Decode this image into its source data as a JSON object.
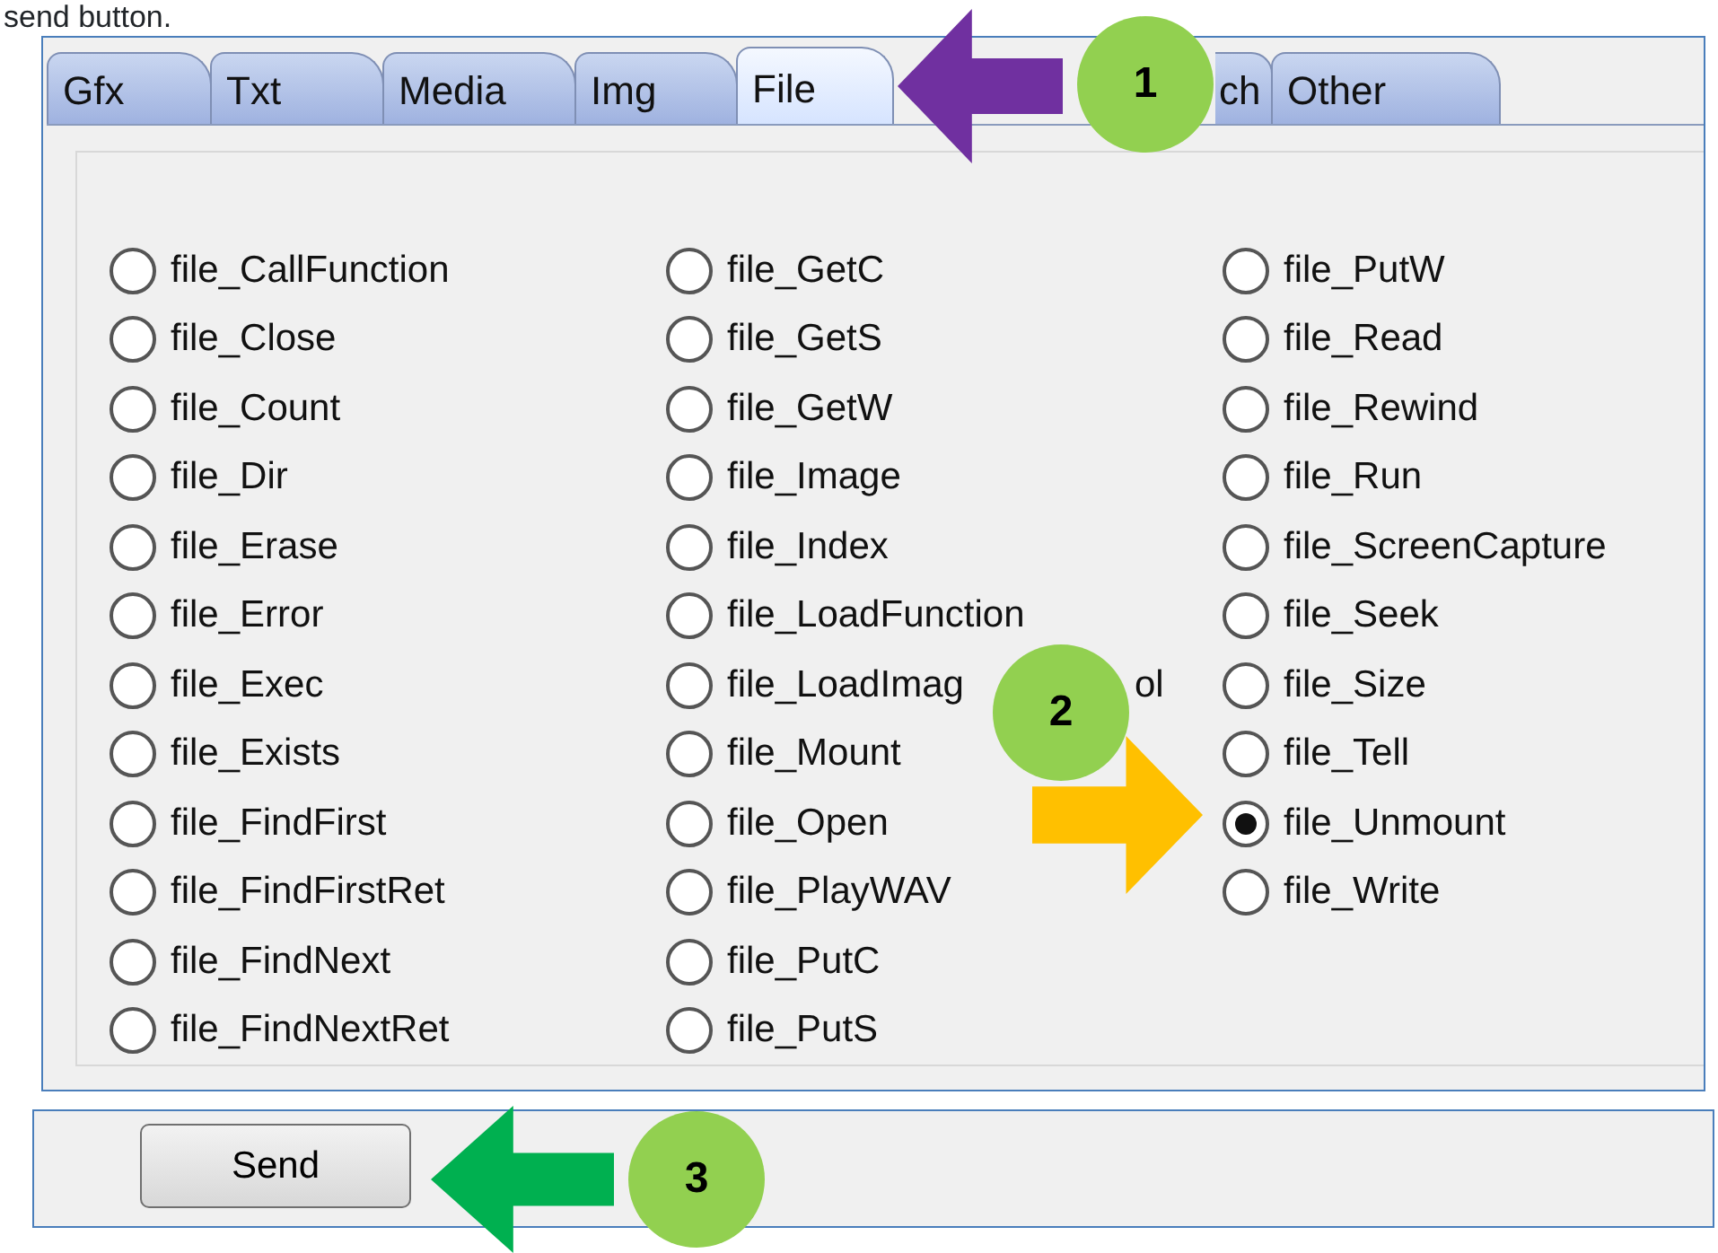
{
  "caption": "send button.",
  "tabs": [
    {
      "label": "Gfx",
      "selected": false
    },
    {
      "label": "Txt",
      "selected": false
    },
    {
      "label": "Media",
      "selected": false
    },
    {
      "label": "Img",
      "selected": false
    },
    {
      "label": "File",
      "selected": true
    },
    {
      "label": "ch",
      "selected": false
    },
    {
      "label": "Other",
      "selected": false
    }
  ],
  "options": [
    [
      {
        "label": "file_CallFunction",
        "selected": false
      },
      {
        "label": "file_Close",
        "selected": false
      },
      {
        "label": "file_Count",
        "selected": false
      },
      {
        "label": "file_Dir",
        "selected": false
      },
      {
        "label": "file_Erase",
        "selected": false
      },
      {
        "label": "file_Error",
        "selected": false
      },
      {
        "label": "file_Exec",
        "selected": false
      },
      {
        "label": "file_Exists",
        "selected": false
      },
      {
        "label": "file_FindFirst",
        "selected": false
      },
      {
        "label": "file_FindFirstRet",
        "selected": false
      },
      {
        "label": "file_FindNext",
        "selected": false
      },
      {
        "label": "file_FindNextRet",
        "selected": false
      }
    ],
    [
      {
        "label": "file_GetC",
        "selected": false
      },
      {
        "label": "file_GetS",
        "selected": false
      },
      {
        "label": "file_GetW",
        "selected": false
      },
      {
        "label": "file_Image",
        "selected": false
      },
      {
        "label": "file_Index",
        "selected": false
      },
      {
        "label": "file_LoadFunction",
        "selected": false
      },
      {
        "label": "file_LoadImag",
        "tail": "ol",
        "selected": false
      },
      {
        "label": "file_Mount",
        "selected": false
      },
      {
        "label": "file_Open",
        "selected": false
      },
      {
        "label": "file_PlayWAV",
        "selected": false
      },
      {
        "label": "file_PutC",
        "selected": false
      },
      {
        "label": "file_PutS",
        "selected": false
      }
    ],
    [
      {
        "label": "file_PutW",
        "selected": false
      },
      {
        "label": "file_Read",
        "selected": false
      },
      {
        "label": "file_Rewind",
        "selected": false
      },
      {
        "label": "file_Run",
        "selected": false
      },
      {
        "label": "file_ScreenCapture",
        "selected": false
      },
      {
        "label": "file_Seek",
        "selected": false
      },
      {
        "label": "file_Size",
        "selected": false
      },
      {
        "label": "file_Tell",
        "selected": false
      },
      {
        "label": "file_Unmount",
        "selected": true
      },
      {
        "label": "file_Write",
        "selected": false
      }
    ]
  ],
  "send_button": "Send",
  "annotations": [
    {
      "kind": "left-arrow",
      "color": "#7030a0"
    },
    {
      "kind": "badge",
      "number": "1",
      "color": "#92d050"
    },
    {
      "kind": "badge",
      "number": "2",
      "color": "#92d050"
    },
    {
      "kind": "right-arrow",
      "color": "#ffc000"
    },
    {
      "kind": "left-arrow",
      "color": "#00b050"
    },
    {
      "kind": "badge",
      "number": "3",
      "color": "#92d050"
    }
  ]
}
